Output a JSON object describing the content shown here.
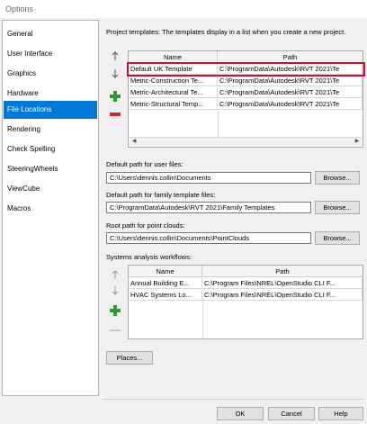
{
  "window": {
    "title": "Options"
  },
  "sidebar": {
    "items": [
      {
        "label": "General",
        "selected": false
      },
      {
        "label": "User Interface",
        "selected": false
      },
      {
        "label": "Graphics",
        "selected": false
      },
      {
        "label": "Hardware",
        "selected": false
      },
      {
        "label": "File Locations",
        "selected": true
      },
      {
        "label": "Rendering",
        "selected": false
      },
      {
        "label": "Check Spelling",
        "selected": false
      },
      {
        "label": "SteeringWheels",
        "selected": false
      },
      {
        "label": "ViewCube",
        "selected": false
      },
      {
        "label": "Macros",
        "selected": false
      }
    ]
  },
  "templates": {
    "caption": "Project templates:  The templates display in a list when you create a new project.",
    "columns": [
      "Name",
      "Path"
    ],
    "rows": [
      {
        "name": "Default UK Template",
        "path": "C:\\ProgramData\\Autodesk\\RVT 2021\\Te"
      },
      {
        "name": "Metric-Construction Te...",
        "path": "C:\\ProgramData\\Autodesk\\RVT 2021\\Te"
      },
      {
        "name": "Metric-Architectural Te...",
        "path": "C:\\ProgramData\\Autodesk\\RVT 2021\\Te"
      },
      {
        "name": "Metric-Structural Temp...",
        "path": "C:\\ProgramData\\Autodesk\\RVT 2021\\Te"
      }
    ]
  },
  "user_files": {
    "label": "Default path for user files:",
    "value": "C:\\Users\\dennis.collin\\Documents",
    "browse": "Browse..."
  },
  "family_templates": {
    "label": "Default path for family template files:",
    "value": "C:\\ProgramData\\Autodesk\\RVT 2021\\Family Templates",
    "browse": "Browse..."
  },
  "point_clouds": {
    "label": "Root path for point clouds:",
    "value": "C:\\Users\\dennis.collin\\Documents\\PointClouds",
    "browse": "Browse..."
  },
  "workflows": {
    "caption": "Systems analysis workflows:",
    "columns": [
      "Name",
      "Path"
    ],
    "rows": [
      {
        "name": "Annual Building E...",
        "path": "C:\\Program Files\\NREL\\OpenStudio CLI F..."
      },
      {
        "name": "HVAC Systems Lo...",
        "path": "C:\\Program Files\\NREL\\OpenStudio CLI F..."
      }
    ]
  },
  "places_button": "Places...",
  "footer": {
    "ok": "OK",
    "cancel": "Cancel",
    "help": "Help"
  },
  "colors": {
    "selection": "#0078d7",
    "highlight": "#c8102e",
    "add": "#2e9a2e",
    "remove": "#d9262c"
  },
  "icons": [
    "move-up-icon",
    "move-down-icon",
    "add-icon",
    "remove-icon"
  ]
}
